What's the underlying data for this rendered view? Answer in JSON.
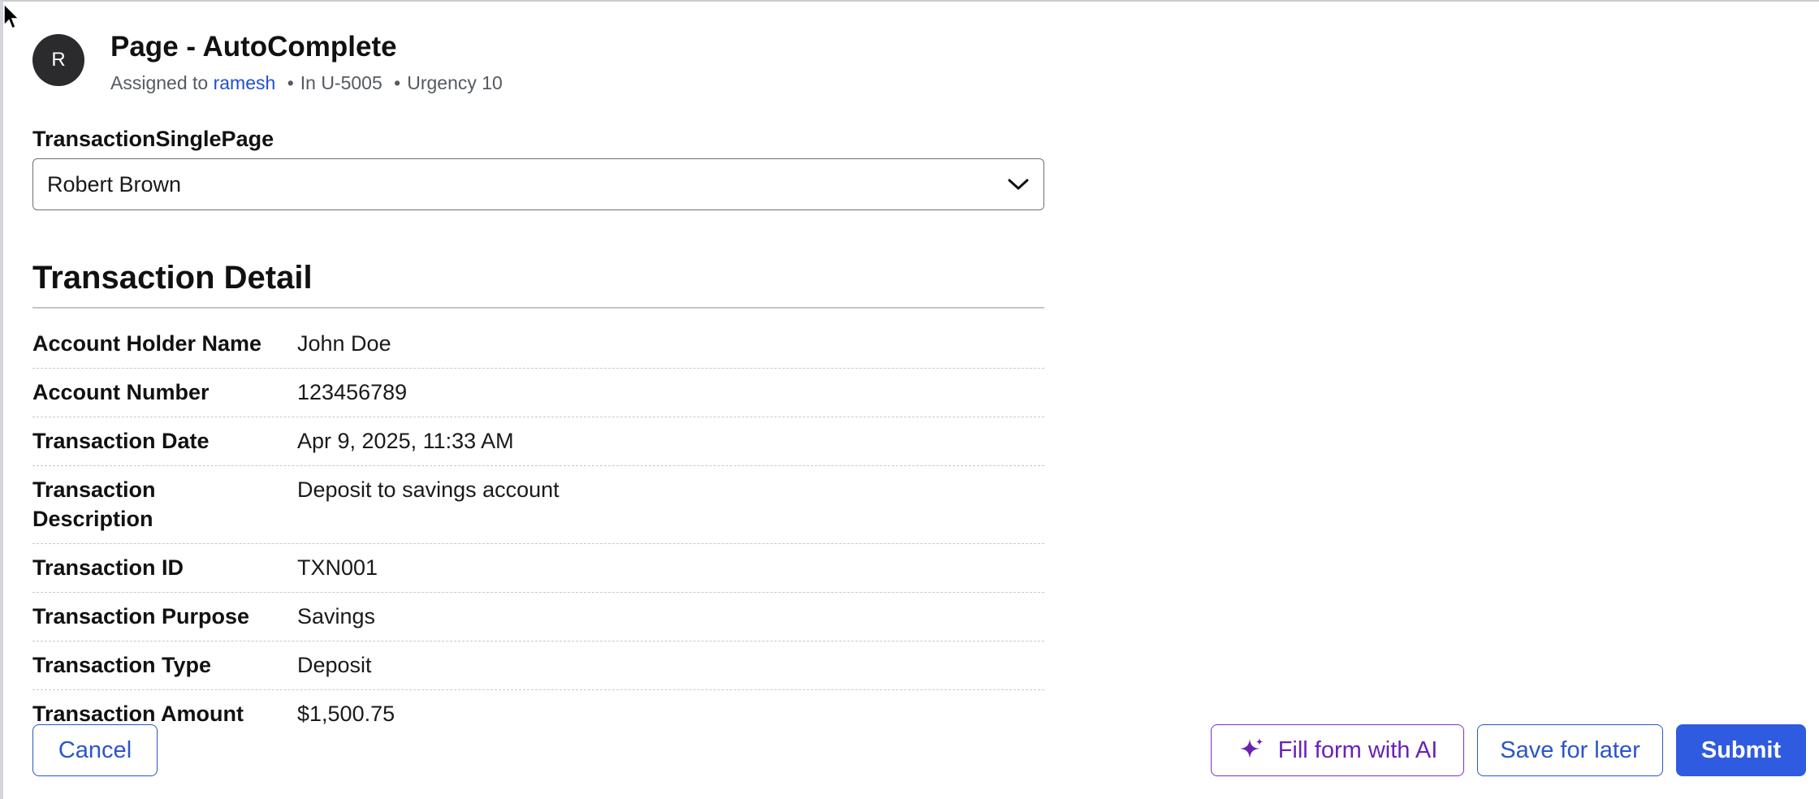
{
  "header": {
    "avatar_initial": "R",
    "title": "Page - AutoComplete",
    "assigned_prefix": "Assigned to",
    "assignee": "ramesh",
    "case_id": "In U-5005",
    "urgency": "Urgency 10"
  },
  "dropdown": {
    "label": "TransactionSinglePage",
    "selected": "Robert Brown"
  },
  "section": {
    "title": "Transaction Detail",
    "rows": [
      {
        "label": "Account Holder Name",
        "value": "John Doe"
      },
      {
        "label": "Account Number",
        "value": "123456789"
      },
      {
        "label": "Transaction Date",
        "value": "Apr 9, 2025, 11:33 AM"
      },
      {
        "label": "Transaction Description",
        "value": "Deposit to savings account"
      },
      {
        "label": "Transaction ID",
        "value": "TXN001"
      },
      {
        "label": "Transaction Purpose",
        "value": "Savings"
      },
      {
        "label": "Transaction Type",
        "value": "Deposit"
      },
      {
        "label": "Transaction Amount",
        "value": "$1,500.75"
      }
    ]
  },
  "actions": {
    "cancel": "Cancel",
    "fill_ai": "Fill form with AI",
    "save_later": "Save for later",
    "submit": "Submit"
  },
  "icons": {
    "cursor": "mouse-pointer-icon",
    "chevron": "chevron-down-icon",
    "sparkle": "sparkle-icon"
  },
  "colors": {
    "link": "#1f4fd1",
    "primary": "#2f5be0",
    "ai_accent": "#7b2fc1",
    "avatar_bg": "#2b2b2e"
  }
}
